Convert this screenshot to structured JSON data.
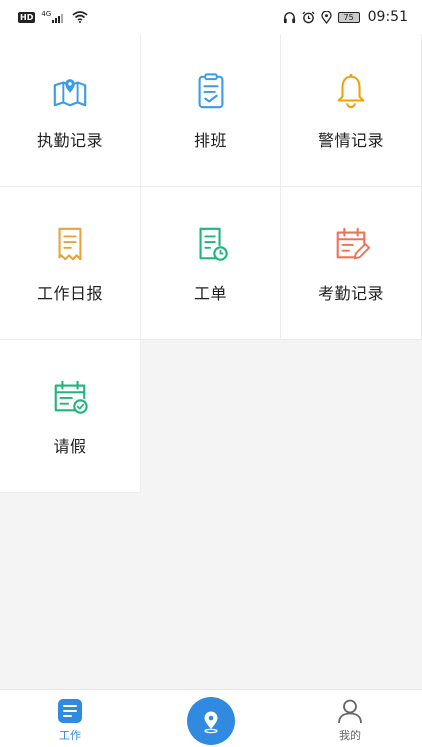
{
  "status_bar": {
    "hd": "HD",
    "network": "4G",
    "battery": "75",
    "time": "09:51",
    "icons": [
      "headset-icon",
      "alarm-icon",
      "location-icon"
    ]
  },
  "tiles": [
    {
      "label": "执勤记录",
      "icon": "map-pin-icon",
      "color": "#3a9be6"
    },
    {
      "label": "排班",
      "icon": "clipboard-check-icon",
      "color": "#3a9be6"
    },
    {
      "label": "警情记录",
      "icon": "bell-icon",
      "color": "#f0a20a"
    },
    {
      "label": "工作日报",
      "icon": "receipt-icon",
      "color": "#e8a33c"
    },
    {
      "label": "工单",
      "icon": "document-clock-icon",
      "color": "#1fb57a"
    },
    {
      "label": "考勤记录",
      "icon": "calendar-edit-icon",
      "color": "#ef7257"
    },
    {
      "label": "请假",
      "icon": "calendar-check-icon",
      "color": "#1fb57a"
    }
  ],
  "tab_bar": {
    "work_label": "工作",
    "mine_label": "我的",
    "accent": "#2f8ae0",
    "center_icon": "location-pin-icon"
  }
}
